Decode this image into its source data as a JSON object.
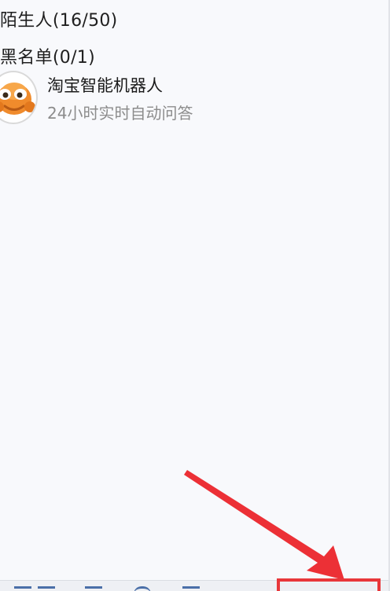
{
  "groups": {
    "strangers_label": "陌生人(16/50)",
    "blacklist_label": "黑名单(0/1)"
  },
  "contact": {
    "name": "淘宝智能机器人",
    "status": "24小时实时自动问答"
  },
  "colors": {
    "background": "#f8f9fc",
    "annotation_red": "#e8373a",
    "mascot_orange": "#f08b2c"
  },
  "icons": {
    "avatar": "taobao-robot-mascot-icon",
    "arrow": "red-arrow-annotation"
  }
}
